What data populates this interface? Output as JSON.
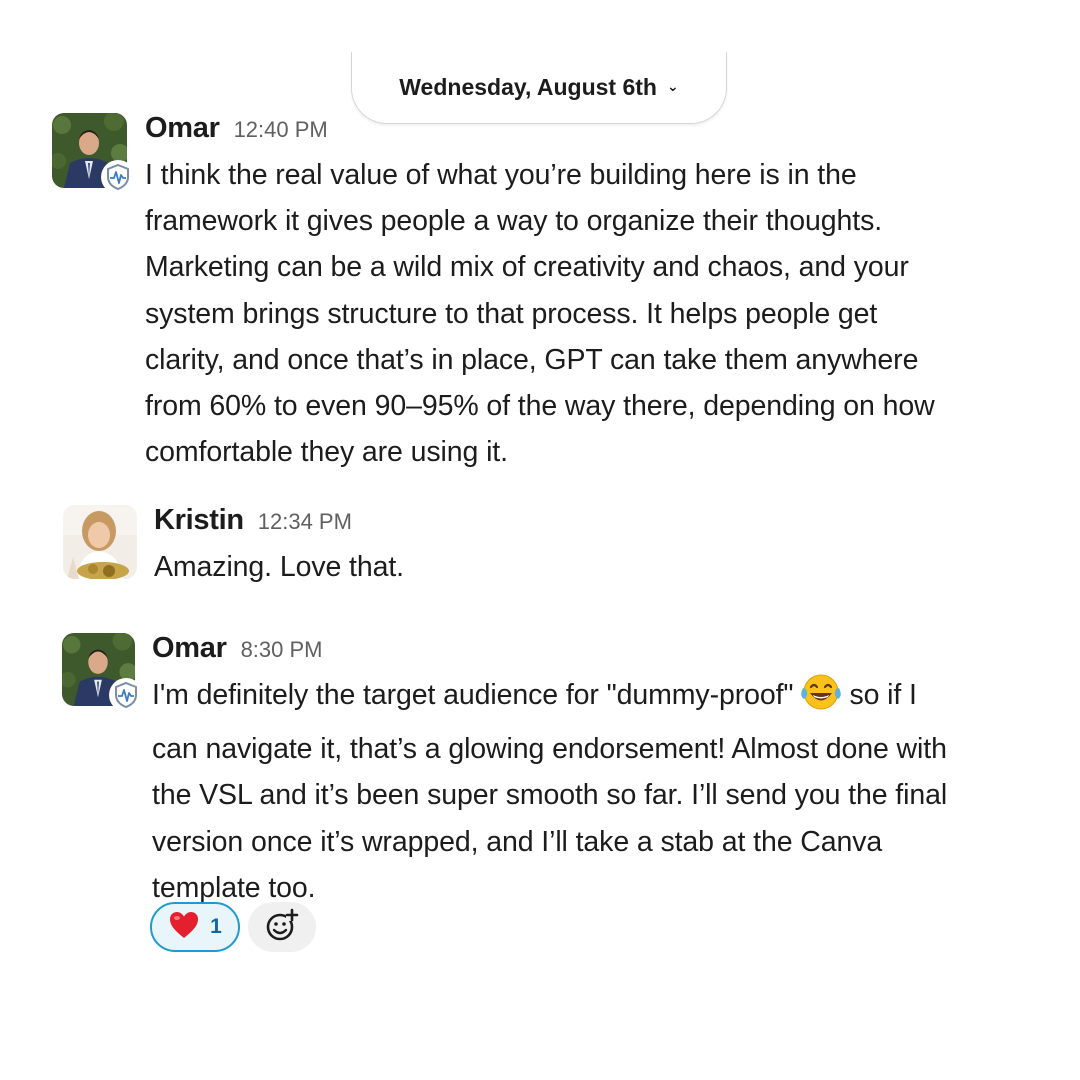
{
  "date_divider": {
    "label": "Wednesday, August 6th",
    "chevron_icon": "chevron-down-icon"
  },
  "messages": [
    {
      "sender": "Omar",
      "time": "12:40 PM",
      "avatar_icon": "omar-avatar",
      "badge_icon": "shield-badge-icon",
      "lines": [
        "I think the real value of what you’re building here is in the",
        "framework it gives people a way to organize their thoughts.",
        "Marketing can be a wild mix of creativity and chaos, and your",
        "system brings structure to that process. It helps people get",
        "clarity, and once that’s in place, GPT can take them anywhere",
        "from 60% to even 90–95% of the way there, depending on how",
        "comfortable they are using it."
      ]
    },
    {
      "sender": "Kristin",
      "time": "12:34 PM",
      "avatar_icon": "kristin-avatar",
      "lines": [
        "Amazing. Love that."
      ]
    },
    {
      "sender": "Omar",
      "time": "8:30 PM",
      "avatar_icon": "omar-avatar",
      "badge_icon": "shield-badge-icon",
      "line1_before_emoji": "I'm definitely the target audience for \"dummy-proof\"",
      "inline_emoji": "joy-emoji-icon",
      "line1_after_emoji": "so if I",
      "lines": [
        "can navigate it, that’s a glowing endorsement! Almost done with",
        "the VSL and it’s been super smooth so far. I’ll send you the final",
        "version once it’s wrapped, and I’ll take a stab at the Canva",
        "template too."
      ],
      "reactions": [
        {
          "emoji": "❤️",
          "icon": "heart-emoji-icon",
          "count": "1",
          "reacted_by_me": true
        }
      ],
      "add_reaction_icon": "add-reaction-icon"
    }
  ],
  "colors": {
    "text": "#1d1c1d",
    "timestamp": "#616061",
    "reaction_border": "#1d9bd1",
    "reaction_bg": "#e8f5fa",
    "reaction_count": "#1264a3",
    "add_reaction_bg": "#f0f0f0",
    "divider_border": "#d6d6d6"
  }
}
